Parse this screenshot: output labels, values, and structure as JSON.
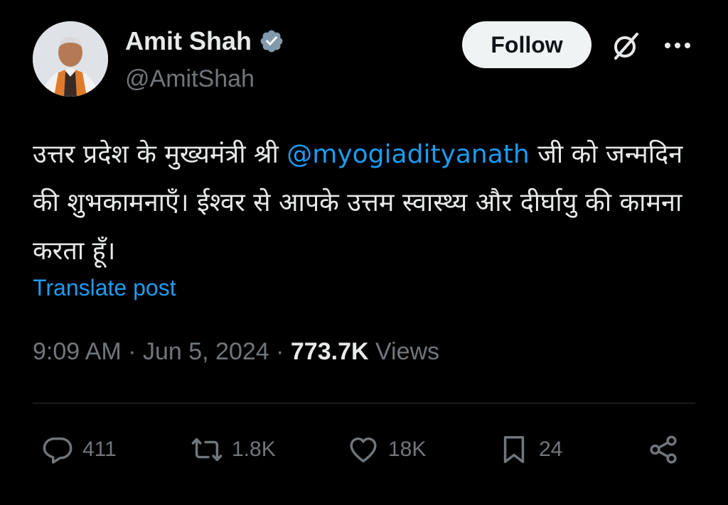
{
  "author": {
    "name": "Amit Shah",
    "handle": "@AmitShah"
  },
  "header": {
    "follow_label": "Follow"
  },
  "tweet": {
    "text_before": "उत्तर प्रदेश के मुख्यमंत्री श्री ",
    "mention": "@myogiadityanath",
    "text_after": " जी को जन्मदिन की शुभकामनाएँ। ईश्वर से आपके उत्तम स्वास्थ्य और दीर्घायु की कामना करता हूँ।",
    "translate_label": "Translate post"
  },
  "meta": {
    "time": "9:09 AM",
    "separator": " · ",
    "date": "Jun 5, 2024",
    "views_count": "773.7K",
    "views_label": " Views"
  },
  "actions": {
    "replies": "411",
    "reposts": "1.8K",
    "likes": "18K",
    "bookmarks": "24"
  },
  "colors": {
    "background": "#000000",
    "text_primary": "#e7e9ea",
    "text_secondary": "#71767b",
    "accent_blue": "#1d9bf0",
    "verified_gray": "#829aab",
    "divider": "#2f3336"
  },
  "icons": {
    "verified": "verified-badge-icon",
    "grok": "grok-icon",
    "more": "more-horizontal-icon",
    "reply": "reply-bubble-icon",
    "repost": "repost-arrows-icon",
    "like": "heart-icon",
    "bookmark": "bookmark-icon",
    "share": "share-nodes-icon"
  }
}
